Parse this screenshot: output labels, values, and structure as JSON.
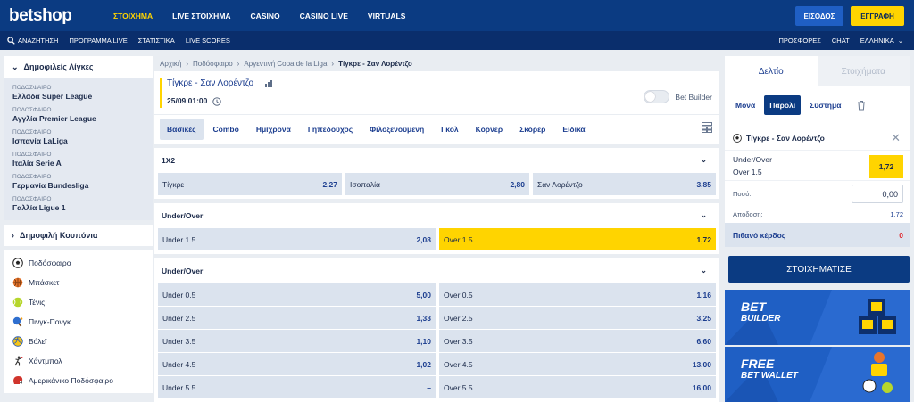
{
  "header": {
    "logo": "betshop",
    "nav": [
      "ΣΤΟΙΧΗΜΑ",
      "LIVE ΣΤΟΙΧΗΜΑ",
      "CASINO",
      "CASINO LIVE",
      "VIRTUALS"
    ],
    "login": "ΕΙΣΟΔΟΣ",
    "register": "ΕΓΓΡΑΦΗ"
  },
  "subnav": {
    "left": [
      "ΑΝΑΖΗΤΗΣΗ",
      "ΠΡΟΓΡΑΜΜΑ LIVE",
      "ΣΤΑΤΙΣΤΙΚΑ",
      "LIVE SCORES"
    ],
    "right": [
      "ΠΡΟΣΦΟΡΕΣ",
      "CHAT",
      "ΕΛΛΗΝΙΚΑ"
    ]
  },
  "sidebar": {
    "popular_title": "Δημοφιλείς Λίγκες",
    "leagues": [
      {
        "cat": "ΠΟΔΟΣΦΑΙΡΟ",
        "name": "Ελλάδα Super League"
      },
      {
        "cat": "ΠΟΔΟΣΦΑΙΡΟ",
        "name": "Αγγλία Premier League"
      },
      {
        "cat": "ΠΟΔΟΣΦΑΙΡΟ",
        "name": "Ισπανία LaLiga"
      },
      {
        "cat": "ΠΟΔΟΣΦΑΙΡΟ",
        "name": "Ιταλία Serie A"
      },
      {
        "cat": "ΠΟΔΟΣΦΑΙΡΟ",
        "name": "Γερμανία Bundesliga"
      },
      {
        "cat": "ΠΟΔΟΣΦΑΙΡΟ",
        "name": "Γαλλία Ligue 1"
      }
    ],
    "coupon_title": "Δημοφιλή Κουπόνια",
    "sports": [
      "Ποδόσφαιρο",
      "Μπάσκετ",
      "Τένις",
      "Πινγκ-Πονγκ",
      "Βόλεϊ",
      "Χάντμπολ",
      "Αμερικάνικο Ποδόσφαιρο"
    ]
  },
  "breadcrumb": [
    "Αρχική",
    "Ποδόσφαιρο",
    "Αργεντινή Copa de la Liga",
    "Τίγκρε - Σαν Λορέντζο"
  ],
  "event": {
    "title": "Τίγκρε - Σαν Λορέντζο",
    "date": "25/09 01:00",
    "bet_builder": "Bet Builder"
  },
  "tabs": [
    "Βασικές",
    "Combo",
    "Ημίχρονα",
    "Γηπεδούχος",
    "Φιλοξενούμενη",
    "Γκολ",
    "Κόρνερ",
    "Σκόρερ",
    "Ειδικά"
  ],
  "markets": [
    {
      "title": "1X2",
      "rows": [
        [
          {
            "label": "Τίγκρε",
            "value": "2,27"
          },
          {
            "label": "Ισοπαλία",
            "value": "2,80"
          },
          {
            "label": "Σαν Λορέντζο",
            "value": "3,85"
          }
        ]
      ]
    },
    {
      "title": "Under/Over",
      "rows": [
        [
          {
            "label": "Under 1.5",
            "value": "2,08"
          },
          {
            "label": "Over 1.5",
            "value": "1,72"
          }
        ]
      ]
    },
    {
      "title": "Under/Over",
      "rows": [
        [
          {
            "label": "Under 0.5",
            "value": "5,00"
          },
          {
            "label": "Over 0.5",
            "value": "1,16"
          }
        ],
        [
          {
            "label": "Under 2.5",
            "value": "1,33"
          },
          {
            "label": "Over 2.5",
            "value": "3,25"
          }
        ],
        [
          {
            "label": "Under 3.5",
            "value": "1,10"
          },
          {
            "label": "Over 3.5",
            "value": "6,60"
          }
        ],
        [
          {
            "label": "Under 4.5",
            "value": "1,02"
          },
          {
            "label": "Over 4.5",
            "value": "13,00"
          }
        ],
        [
          {
            "label": "Under 5.5",
            "value": "–"
          },
          {
            "label": "Over 5.5",
            "value": "16,00"
          }
        ]
      ]
    }
  ],
  "betslip": {
    "tab_active": "Δελτίο",
    "tab_inactive": "Στοιχήματα",
    "modes": [
      "Μονά",
      "Παρολί",
      "Σύστημα"
    ],
    "selection_event": "Τίγκρε - Σαν Λορέντζο",
    "selection_market": "Under/Over",
    "selection_pick": "Over 1.5",
    "selection_odd": "1,72",
    "stake_label": "Ποσό:",
    "stake_value": "0,00",
    "return_label": "Απόδοση:",
    "return_value": "1,72",
    "win_label": "Πιθανό κέρδος",
    "win_value": "0",
    "bet_button": "ΣΤΟΙΧΗΜΑΤΙΣΕ"
  },
  "promos": [
    {
      "l1": "BET",
      "l2": "BUILDER"
    },
    {
      "l1": "FREE",
      "l2": "BET WALLET"
    }
  ],
  "colors": {
    "primary": "#0b3b82",
    "accent": "#ffd400",
    "odds_bg": "#dbe3ee",
    "win": "#e0262d"
  }
}
